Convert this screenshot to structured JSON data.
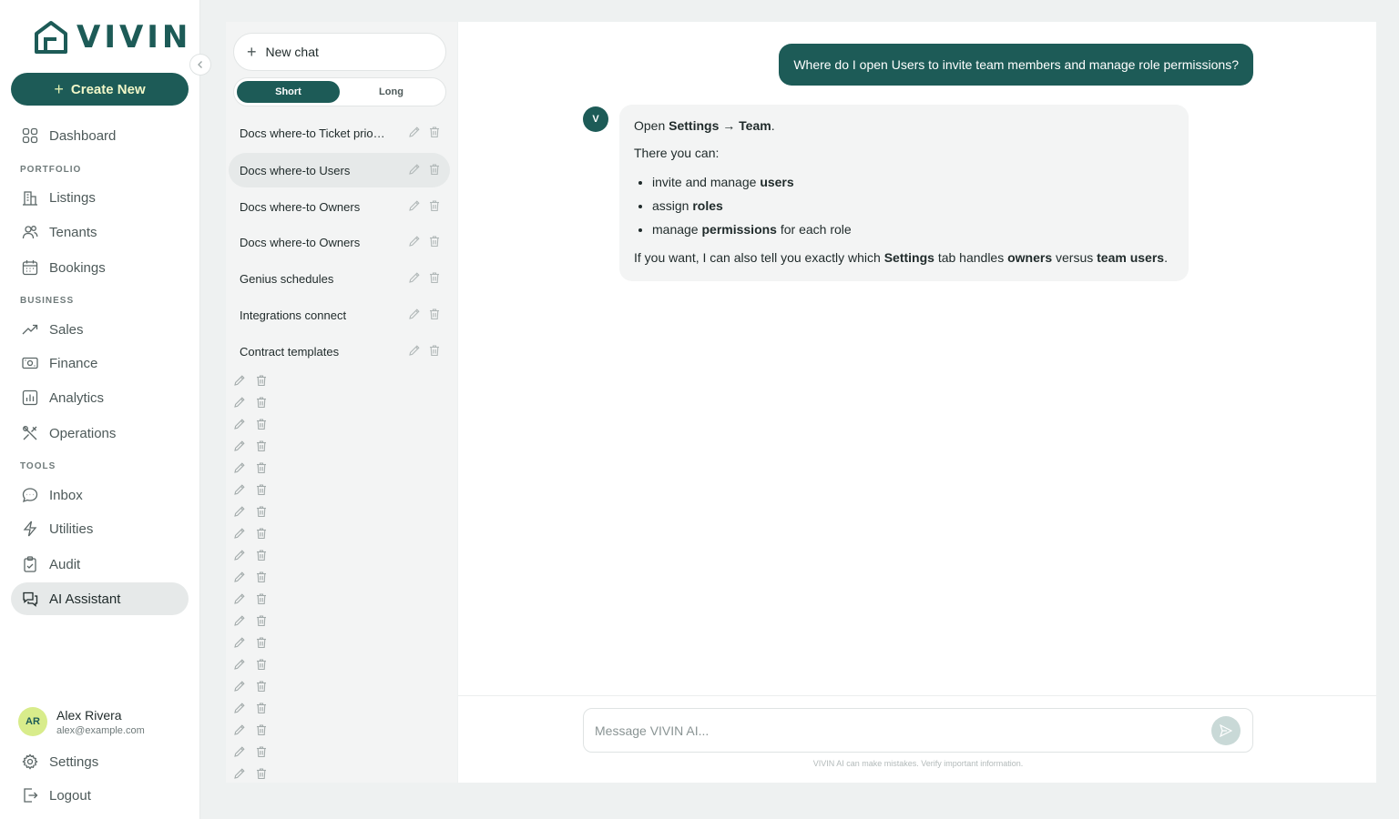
{
  "brand": {
    "name": "VIVIN"
  },
  "sidebar": {
    "create_label": "Create New",
    "dashboard": "Dashboard",
    "sections": {
      "portfolio": "PORTFOLIO",
      "business": "BUSINESS",
      "tools": "TOOLS"
    },
    "items": [
      {
        "label": "Dashboard",
        "icon": "grid-icon"
      },
      {
        "label": "Listings",
        "icon": "building-icon"
      },
      {
        "label": "Tenants",
        "icon": "users-icon"
      },
      {
        "label": "Bookings",
        "icon": "calendar-icon"
      },
      {
        "label": "Sales",
        "icon": "trend-up-icon"
      },
      {
        "label": "Finance",
        "icon": "money-icon"
      },
      {
        "label": "Analytics",
        "icon": "bar-chart-icon"
      },
      {
        "label": "Operations",
        "icon": "tools-icon"
      },
      {
        "label": "Inbox",
        "icon": "chat-icon"
      },
      {
        "label": "Utilities",
        "icon": "bolt-icon"
      },
      {
        "label": "Audit",
        "icon": "clipboard-icon"
      },
      {
        "label": "AI Assistant",
        "icon": "ai-chat-icon"
      }
    ],
    "user": {
      "initials": "AR",
      "name": "Alex Rivera",
      "email": "alex@example.com"
    },
    "settings": "Settings",
    "logout": "Logout"
  },
  "history": {
    "new_chat": "New chat",
    "length_options": [
      "Short",
      "Long"
    ],
    "selected_length": "Short",
    "chats": [
      "Docs where-to Ticket prio…",
      "Docs where-to Users",
      "Docs where-to Owners",
      "Docs where-to Owners",
      "Genius schedules",
      "Integrations connect",
      "Contract templates"
    ],
    "active_chat_index": 1
  },
  "chat": {
    "user_message": "Where do I open Users to invite team members and manage role permissions?",
    "bot_initial": "V",
    "bot": {
      "line1_pre": "Open ",
      "line1_bold": "Settings → Team",
      "line1_post": ".",
      "line2": "There you can:",
      "b1_pre": "invite and manage ",
      "b1_bold": "users",
      "b2_pre": "assign ",
      "b2_bold": "roles",
      "b3_pre": "manage ",
      "b3_bold": "permissions",
      "b3_post": " for each role",
      "p3_a": "If you want, I can also tell you exactly which ",
      "p3_b": "Settings",
      "p3_c": " tab handles ",
      "p3_d": "owners",
      "p3_e": " versus ",
      "p3_f": "team users",
      "p3_g": "."
    },
    "input_placeholder": "Message VIVIN AI...",
    "disclaimer": "VIVIN AI can make mistakes. Verify important information."
  },
  "colors": {
    "brand": "#1d5b57",
    "accent": "#d8ec8b"
  }
}
